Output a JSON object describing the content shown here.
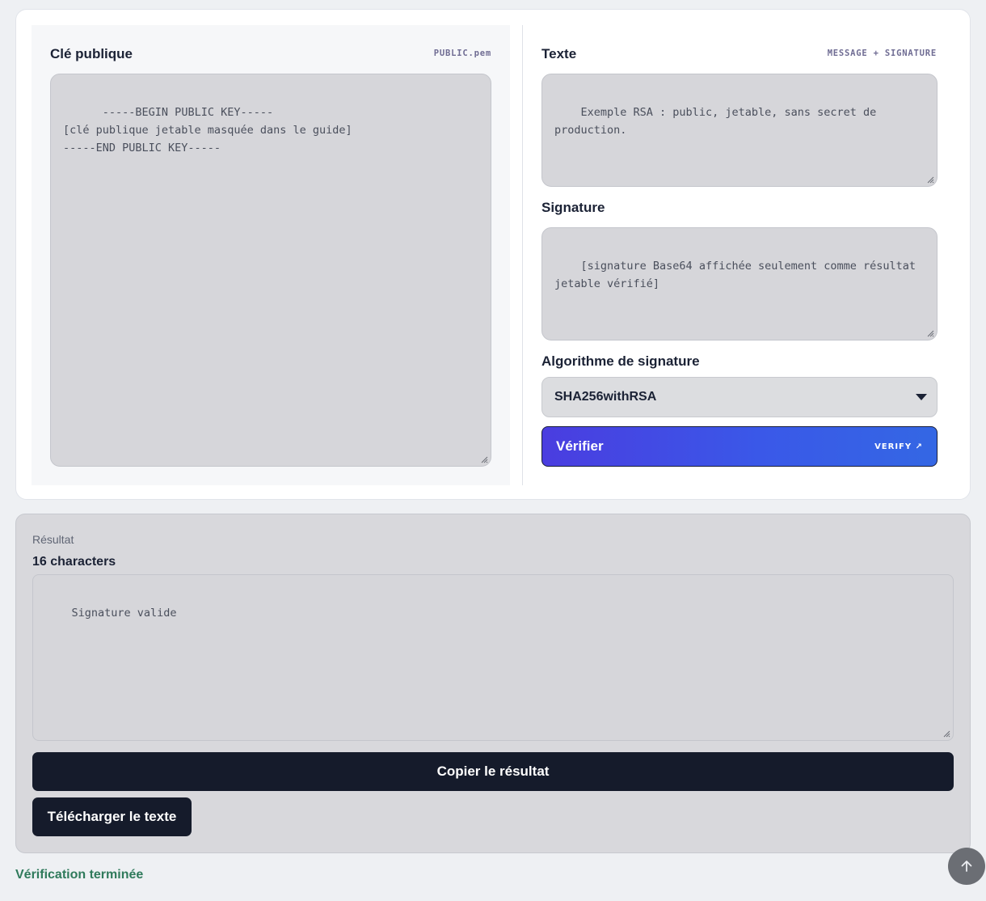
{
  "public_key": {
    "label": "Clé publique",
    "tag": "PUBLIC.pem",
    "value": "-----BEGIN PUBLIC KEY-----\n[clé publique jetable masquée dans le guide]\n-----END PUBLIC KEY-----"
  },
  "text": {
    "label": "Texte",
    "tag": "MESSAGE + SIGNATURE",
    "value": "Exemple RSA : public, jetable, sans secret de production."
  },
  "signature": {
    "label": "Signature",
    "value": "[signature Base64 affichée seulement comme résultat jetable vérifié]"
  },
  "algorithm": {
    "label": "Algorithme de signature",
    "selected": "SHA256withRSA"
  },
  "verify_button": {
    "label": "Vérifier",
    "sub_label": "VERIFY ↗"
  },
  "result": {
    "label": "Résultat",
    "count": "16 characters",
    "value": "Signature valide",
    "copy_label": "Copier le résultat",
    "download_label": "Télécharger le texte"
  },
  "status": "Vérification terminée",
  "icons": {
    "scroll_top": "arrow-up-icon",
    "select": "caret-down-icon"
  }
}
